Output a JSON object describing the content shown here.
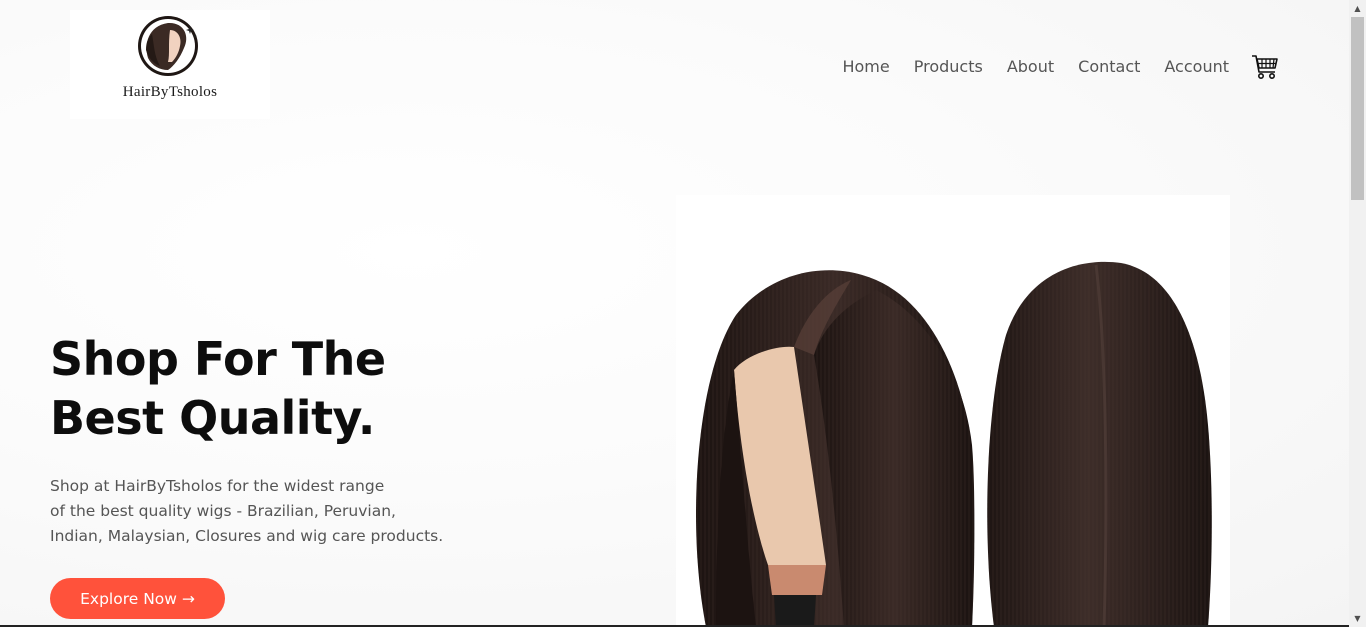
{
  "brand": {
    "name": "HairByTsholos",
    "logo_icon": "woman-profile-logo"
  },
  "nav": {
    "items": [
      {
        "label": "Home"
      },
      {
        "label": "Products"
      },
      {
        "label": "About"
      },
      {
        "label": "Contact"
      },
      {
        "label": "Account"
      }
    ],
    "cart_icon": "shopping-cart-icon"
  },
  "hero": {
    "title_line1": "Shop For The",
    "title_line2": "Best Quality.",
    "description_line1": "Shop at HairByTsholos for the widest range",
    "description_line2": "of the best quality wigs - Brazilian, Peruvian,",
    "description_line3": "Indian, Malaysian, Closures and wig care products.",
    "cta_label": "Explore Now →",
    "image_subject": "two-bob-wigs-product-photo"
  },
  "colors": {
    "accent": "#ff523b",
    "heading": "#0d0d0d",
    "body_text": "#555555",
    "hair": "#2a1d1b"
  }
}
